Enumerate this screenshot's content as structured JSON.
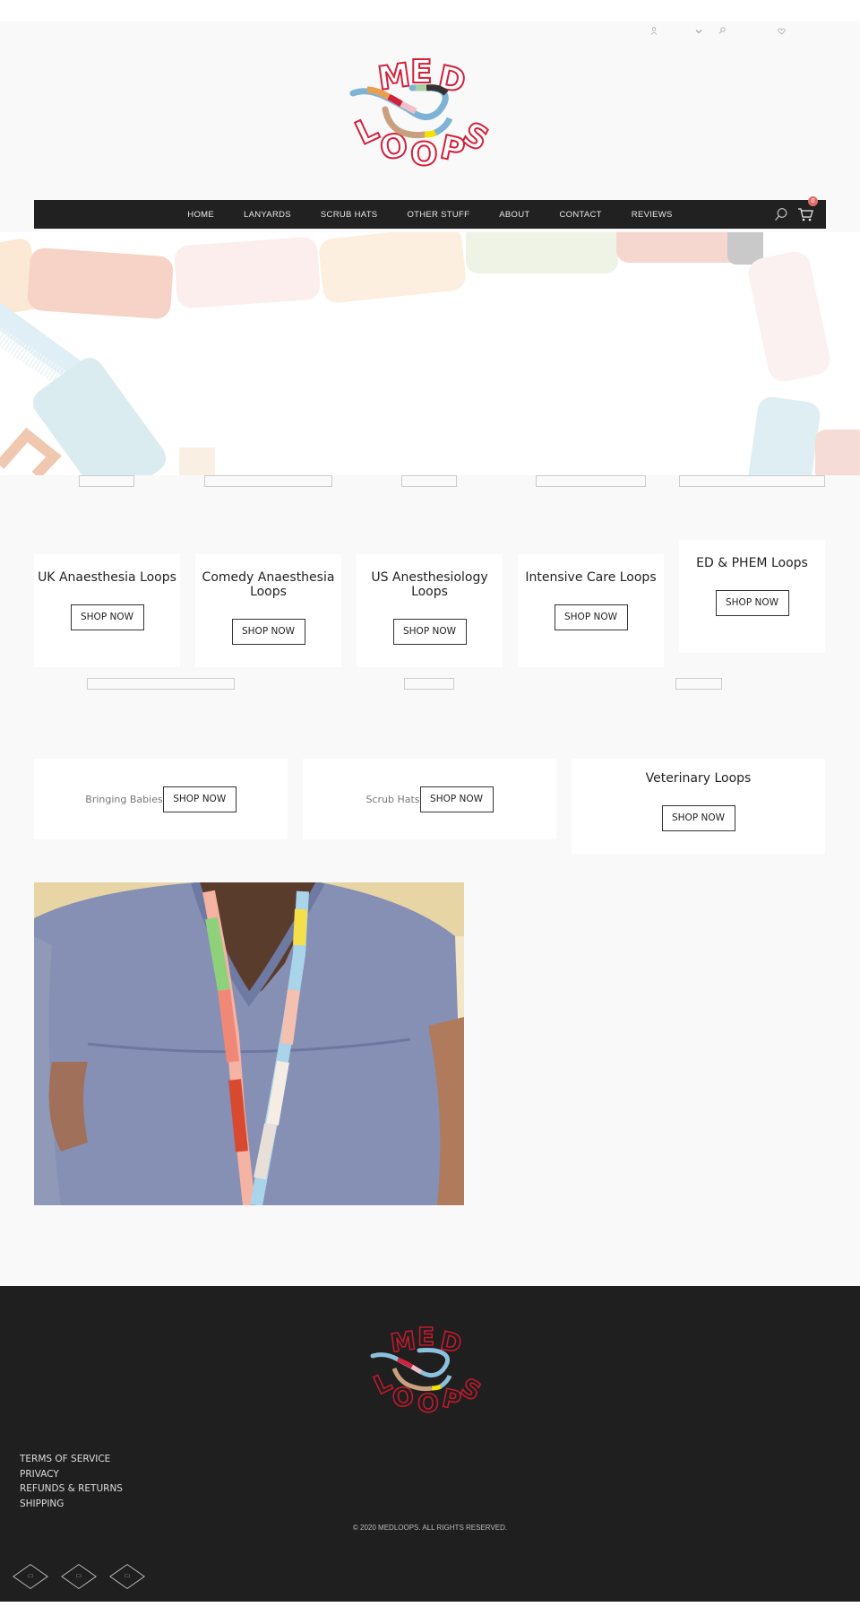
{
  "topbar": {
    "icons": [
      "user-icon",
      "chevron-down-icon",
      "search-icon",
      "heart-icon"
    ]
  },
  "brand": {
    "logo_line1": "MED",
    "logo_line2": "LOOPS",
    "logo_color": "#d4203a"
  },
  "nav": {
    "items": [
      {
        "label": "HOME"
      },
      {
        "label": "LANYARDS"
      },
      {
        "label": "SCRUB HATS"
      },
      {
        "label": "OTHER STUFF"
      },
      {
        "label": "ABOUT"
      },
      {
        "label": "CONTACT"
      },
      {
        "label": "REVIEWS"
      }
    ],
    "cart_count": "0",
    "accent": "#e36b6b"
  },
  "categories_row1": [
    {
      "title": "UK Anaesthesia Loops",
      "button": "SHOP NOW"
    },
    {
      "title": "Comedy Anaesthesia Loops",
      "button": "SHOP NOW"
    },
    {
      "title": "US Anesthesiology Loops",
      "button": "SHOP NOW"
    },
    {
      "title": "Intensive Care Loops",
      "button": "SHOP NOW"
    },
    {
      "title": "ED & PHEM Loops",
      "button": "SHOP NOW"
    }
  ],
  "categories_row2": [
    {
      "title": "Bringing Babies",
      "button": "SHOP NOW"
    },
    {
      "title": "Scrub Hats",
      "button": "SHOP NOW"
    },
    {
      "title": "Veterinary Loops",
      "button": "SHOP NOW"
    }
  ],
  "footer": {
    "links": [
      {
        "label": "TERMS OF SERVICE"
      },
      {
        "label": "PRIVACY"
      },
      {
        "label": "REFUNDS & RETURNS"
      },
      {
        "label": "SHIPPING"
      }
    ],
    "copyright": "© 2020 MEDLOOPS. ALL RIGHTS RESERVED.",
    "social_icons": [
      "facebook-icon",
      "instagram-icon",
      "twitter-icon"
    ]
  }
}
